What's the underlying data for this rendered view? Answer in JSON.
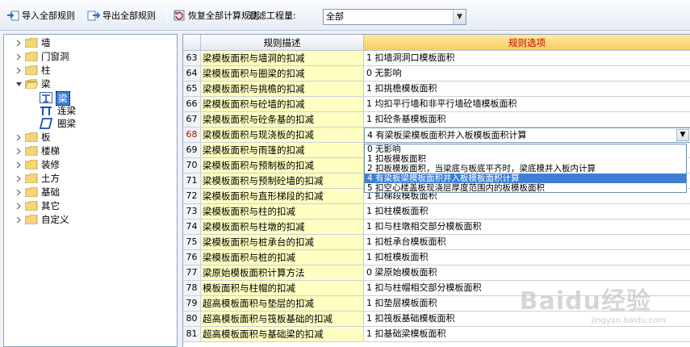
{
  "toolbar": {
    "import_label": "导入全部规则",
    "export_label": "导出全部规则",
    "restore_label": "恢复全部计算规则",
    "filter_label": "过滤工程量:",
    "filter_value": "全部"
  },
  "tree": {
    "items": [
      {
        "label": "墙"
      },
      {
        "label": "门窗洞"
      },
      {
        "label": "柱"
      },
      {
        "label": "梁"
      },
      {
        "label": "梁"
      },
      {
        "label": "连梁"
      },
      {
        "label": "圈梁"
      },
      {
        "label": "板"
      },
      {
        "label": "楼梯"
      },
      {
        "label": "装修"
      },
      {
        "label": "土方"
      },
      {
        "label": "基础"
      },
      {
        "label": "其它"
      },
      {
        "label": "自定义"
      }
    ]
  },
  "grid": {
    "headers": {
      "desc": "规则描述",
      "option": "规则选项"
    },
    "rows": [
      {
        "num": "63",
        "desc": "梁模板面积与墙洞的扣减",
        "option": "1  扣墙洞洞口模板面积"
      },
      {
        "num": "64",
        "desc": "梁模板面积与圈梁的扣减",
        "option": "0    无影响"
      },
      {
        "num": "65",
        "desc": "梁模板面积与挑檐的扣减",
        "option": "1  扣挑檐模板面积"
      },
      {
        "num": "66",
        "desc": "梁模板面积与砼墙的扣减",
        "option": "1  均扣平行墙和非平行墙砼墙模板面积"
      },
      {
        "num": "67",
        "desc": "梁模板面积与砼条基的扣减",
        "option": "1  扣砼条基模板面积"
      },
      {
        "num": "68",
        "desc": "梁模板面积与现浇板的扣减",
        "option": "4  有梁板梁模板面积并入板模板面积计算"
      },
      {
        "num": "69",
        "desc": "梁模板面积与雨篷的扣减",
        "option": ""
      },
      {
        "num": "70",
        "desc": "梁模板面积与预制板的扣减",
        "option": ""
      },
      {
        "num": "71",
        "desc": "梁模板面积与预制砼墙的扣减",
        "option": ""
      },
      {
        "num": "72",
        "desc": "梁模板面积与直形梯段的扣减",
        "option": "1  扣梯段模板面积"
      },
      {
        "num": "73",
        "desc": "梁模板面积与柱的扣减",
        "option": "1  扣柱模板面积"
      },
      {
        "num": "74",
        "desc": "梁模板面积与柱墩的扣减",
        "option": "1  扣与柱墩相交部分模板面积"
      },
      {
        "num": "75",
        "desc": "梁模板面积与桩承台的扣减",
        "option": "1  扣桩承台模板面积"
      },
      {
        "num": "76",
        "desc": "梁模板面积与桩的扣减",
        "option": "1  扣桩模板面积"
      },
      {
        "num": "77",
        "desc": "梁原始模板面积计算方法",
        "option": "0  梁原始模板面积"
      },
      {
        "num": "78",
        "desc": "模板面积与柱帽的扣减",
        "option": "1  扣与柱帽相交部分模板面积"
      },
      {
        "num": "79",
        "desc": "超高模板面积与垫层的扣减",
        "option": "1  扣垫层模板面积"
      },
      {
        "num": "80",
        "desc": "超高模板面积与筏板基础的扣减",
        "option": "1  扣筏板基础模板面积"
      },
      {
        "num": "81",
        "desc": "超高模板面积与基础梁的扣减",
        "option": "1  扣基础梁模板面积"
      }
    ]
  },
  "dropdown": {
    "options": [
      "0    无影响",
      "1  扣板模板面积",
      "2  扣板模板面积，当梁底与板底平齐时，梁底模并入板内计算",
      "4  有梁板梁模板面积并入板模板面积计算",
      "5  扣空心楼盖板现浇层厚度范围内的板模板面积"
    ],
    "selected_index": 3
  },
  "watermark": {
    "text": "Baidu经验",
    "sub": "jingyan.baidu.com"
  },
  "colors": {
    "accent": "#3d7fd6",
    "desc_bg": "#ffffc2",
    "header_option": "#f9cd57",
    "active_num": "#c00000"
  }
}
